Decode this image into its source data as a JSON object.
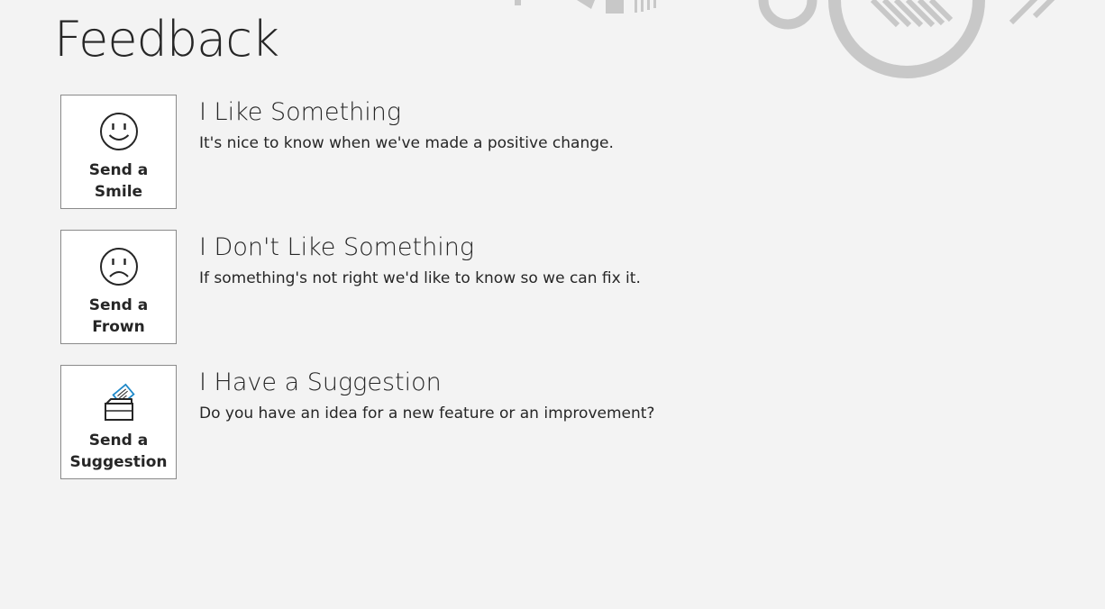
{
  "page": {
    "title": "Feedback"
  },
  "colors": {
    "background": "#f3f3f3",
    "text": "#262626",
    "tile_background": "#ffffff",
    "tile_border": "#8a8a8a",
    "decoration": "#c8c8c8",
    "accent": "#1e88c8"
  },
  "options": [
    {
      "icon": "smile-icon",
      "button_label": "Send a Smile",
      "heading": "I Like Something",
      "description": "It's nice to know when we've made a positive change."
    },
    {
      "icon": "frown-icon",
      "button_label": "Send a Frown",
      "heading": "I Don't Like Something",
      "description": "If something's not right we'd like to know so we can fix it."
    },
    {
      "icon": "suggestion-box-icon",
      "button_label": "Send a Suggestion",
      "heading": "I Have a Suggestion",
      "description": "Do you have an idea for a new feature or an improvement?"
    }
  ]
}
